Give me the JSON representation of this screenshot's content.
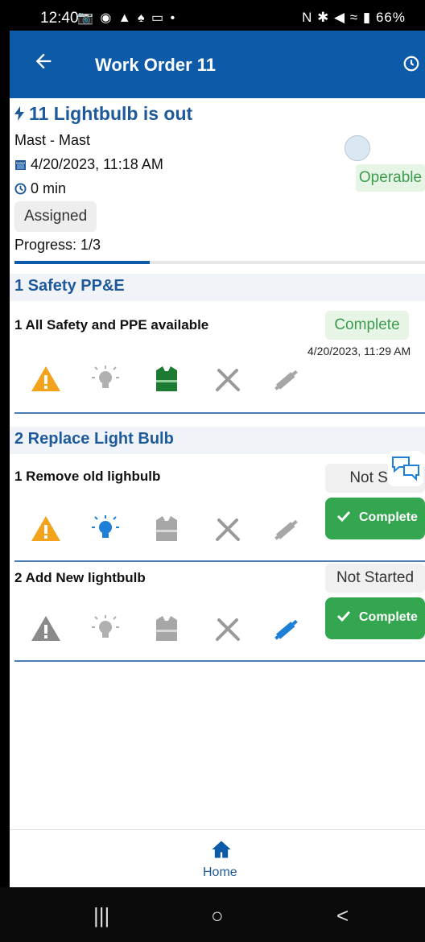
{
  "status_bar": {
    "time": "12:40",
    "icons_left": "📷 ◉ ▲ ♠ ▭ •",
    "icons_right": "N ✱ ◀ ≈ ▮ 66%"
  },
  "app_bar": {
    "title": "Work Order 11"
  },
  "work_order": {
    "heading": "11 Lightbulb is out",
    "location": "Mast - Mast",
    "date": "4/20/2023, 11:18 AM",
    "duration": "0 min",
    "status": "Assigned",
    "condition": "Operable",
    "progress_text": "Progress: 1/3",
    "progress_fraction": 0.33
  },
  "sections": [
    {
      "title": "1 Safety PP&E",
      "tasks": [
        {
          "title": "1 All Safety and PPE available",
          "status": "Complete",
          "timestamp": "4/20/2023, 11:29 AM"
        }
      ]
    },
    {
      "title": "2 Replace Light Bulb",
      "tasks": [
        {
          "title": "1 Remove old lighbulb",
          "status": "Not Sta",
          "button": "Complete"
        },
        {
          "title": "2 Add New lightbulb",
          "status": "Not Started",
          "button": "Complete"
        }
      ]
    }
  ],
  "colors": {
    "primary": "#0d5ba8",
    "warning": "#f2a21b",
    "green": "#34a64f",
    "gray": "#a7a7a7",
    "blue_icon": "#1e7fd8"
  },
  "bottom_nav": {
    "home_label": "Home"
  },
  "system_nav": {
    "recent": "|||",
    "home": "○",
    "back": "<"
  }
}
